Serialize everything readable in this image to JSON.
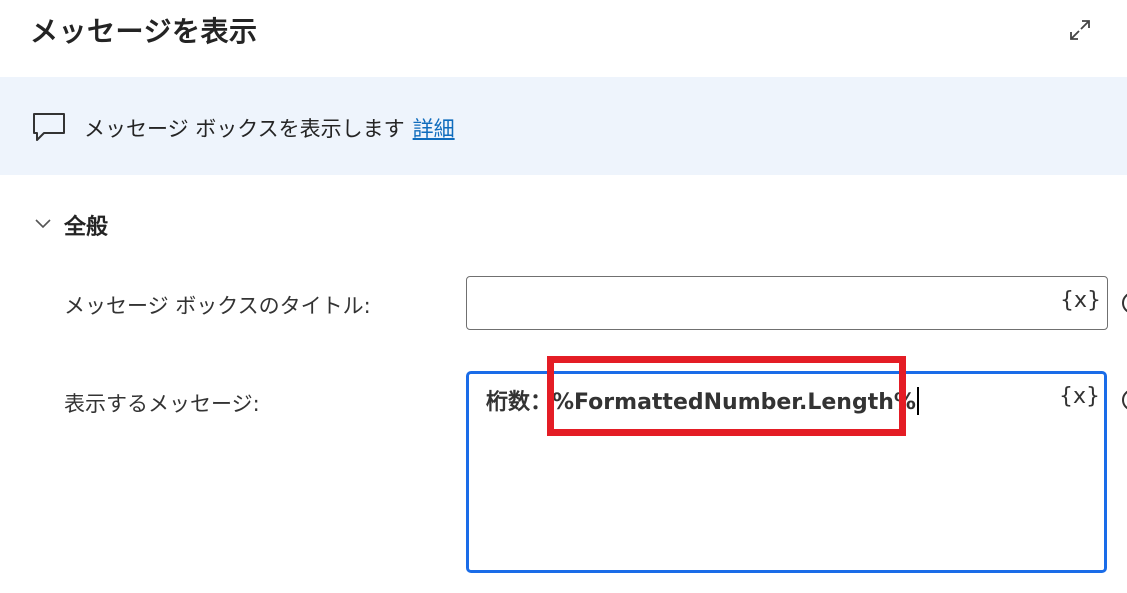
{
  "header": {
    "title": "メッセージを表示",
    "expand_icon": "expand-icon"
  },
  "banner": {
    "icon": "chat-bubble-icon",
    "description": "メッセージ ボックスを表示します",
    "link": "詳細"
  },
  "section": {
    "title": "全般",
    "icon": "chevron-down-icon"
  },
  "fields": {
    "title_label": "メッセージ ボックスのタイトル:",
    "title_value": "",
    "message_label": "表示するメッセージ:",
    "message_value": "桁数：%FormattedNumber.Length%",
    "variable_button": "{x}"
  },
  "colors": {
    "focus_border": "#1a6ce8",
    "highlight_box": "#e41d25",
    "link": "#0f6cbd",
    "banner_bg": "#eef4fc"
  }
}
